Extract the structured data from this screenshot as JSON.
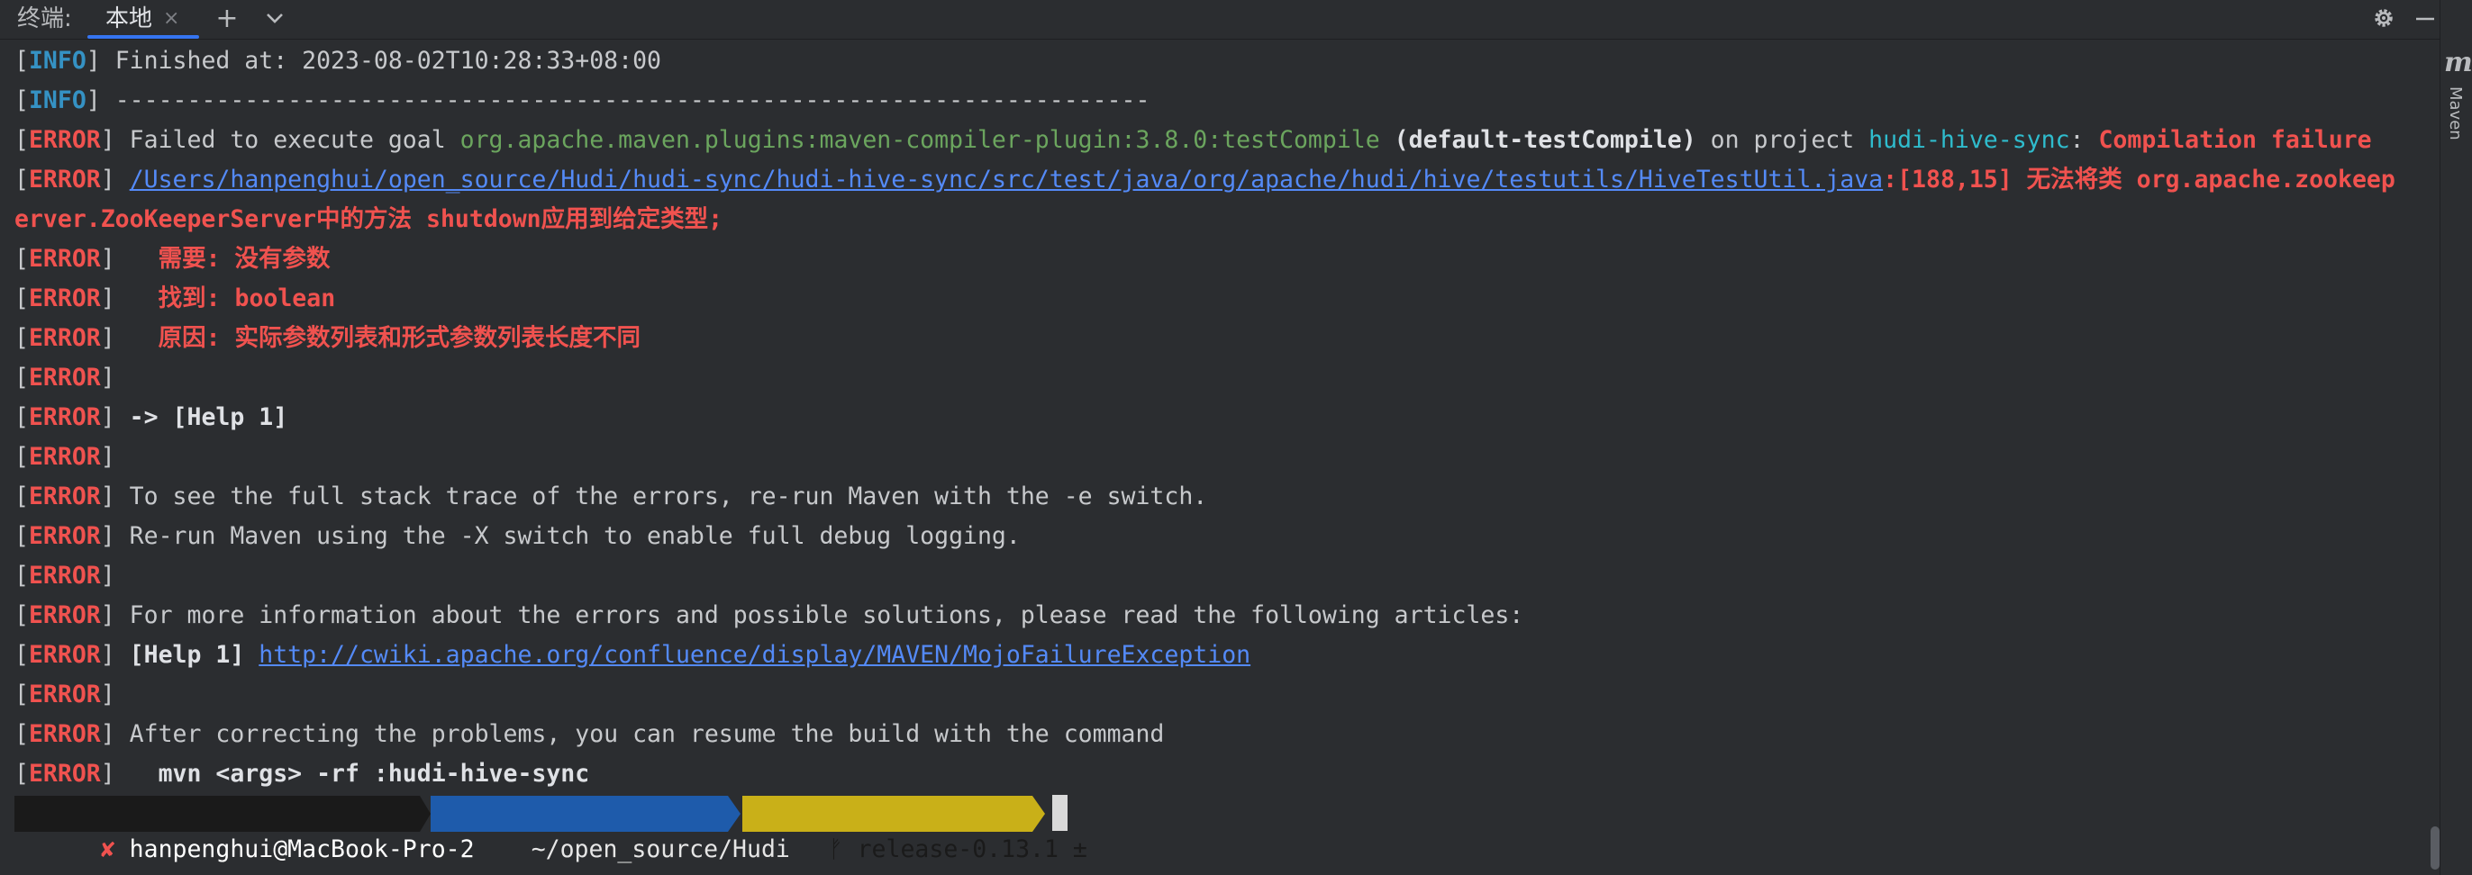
{
  "tabbar": {
    "title": "终端:",
    "tab_label": "本地",
    "tab_close": "×",
    "add_label": "+",
    "dropdown_label": "⌄",
    "settings_label": "⚙",
    "minimize_label": "—"
  },
  "right_strip": {
    "m_label": "m",
    "label": "Maven"
  },
  "terminal": {
    "lines": [
      {
        "tag": "INFO",
        "text": " Finished at: 2023-08-02T10:28:33+08:00"
      },
      {
        "tag": "INFO",
        "text": " ------------------------------------------------------------------------"
      },
      {
        "tag": "ERROR",
        "pre": " Failed to execute goal ",
        "goal": "org.apache.maven.plugins:maven-compiler-plugin:3.8.0:testCompile",
        "exec": " (default-testCompile)",
        "on": " on project ",
        "project": "hudi-hive-sync",
        "colon": ": ",
        "failure": "Compilation failure"
      },
      {
        "tag": "ERROR",
        "path": "/Users/hanpenghui/open_source/Hudi/hudi-sync/hudi-hive-sync/src/test/java/org/apache/hudi/hive/testutils/HiveTestUtil.java",
        "msg": ":[188,15] 无法将类 org.apache.zookeep"
      },
      {
        "text": "erver.ZooKeeperServer中的方法 shutdown应用到给定类型;"
      },
      {
        "tag": "ERROR",
        "text": "   需要: 没有参数"
      },
      {
        "tag": "ERROR",
        "text": "   找到: boolean"
      },
      {
        "tag": "ERROR",
        "text": "   原因: 实际参数列表和形式参数列表长度不同"
      },
      {
        "tag": "ERROR",
        "text": ""
      },
      {
        "tag": "ERROR",
        "text": " -> [Help 1]"
      },
      {
        "tag": "ERROR",
        "text": ""
      },
      {
        "tag": "ERROR",
        "text": " To see the full stack trace of the errors, re-run Maven with the -e switch."
      },
      {
        "tag": "ERROR",
        "text": " Re-run Maven using the -X switch to enable full debug logging."
      },
      {
        "tag": "ERROR",
        "text": ""
      },
      {
        "tag": "ERROR",
        "text": " For more information about the errors and possible solutions, please read the following articles:"
      },
      {
        "tag": "ERROR",
        "pre": " [Help 1] ",
        "url": "http://cwiki.apache.org/confluence/display/MAVEN/MojoFailureException"
      },
      {
        "tag": "ERROR",
        "text": ""
      },
      {
        "tag": "ERROR",
        "text": " After correcting the problems, you can resume the build with the command"
      },
      {
        "tag": "ERROR",
        "text": "   mvn <args> -rf :hudi-hive-sync"
      }
    ],
    "prompt": {
      "fail_mark": "✘",
      "user_host": " hanpenghui@MacBook-Pro-2 ",
      "dir": " ~/open_source/Hudi ",
      "branch_icon": "ᚠ",
      "branch": " release-0.13.1 ±"
    }
  },
  "colors": {
    "background": "#2b2d30",
    "info": "#3592c4",
    "error": "#f0524f",
    "goal": "#6ba55e",
    "project": "#2fbccd",
    "link": "#548af7",
    "prompt_user_bg": "#1a1a1a",
    "prompt_dir_bg": "#1e5bab",
    "prompt_git_bg": "#c9b018",
    "tab_underline": "#3574f0"
  }
}
